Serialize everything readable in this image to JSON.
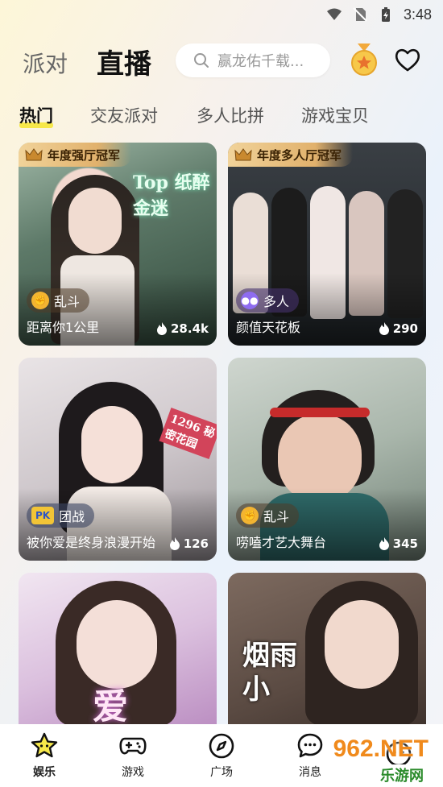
{
  "status": {
    "time": "3:48"
  },
  "header": {
    "tab_party": "派对",
    "tab_live": "直播",
    "search_placeholder": "赢龙佑千载..."
  },
  "subtabs": [
    "热门",
    "交友派对",
    "多人比拼",
    "游戏宝贝"
  ],
  "cards": [
    {
      "badge": "年度强厅冠军",
      "tag": "乱斗",
      "title": "距离你1公里",
      "heat": "28.4k",
      "overlay": "Top 纸醉金迷"
    },
    {
      "badge": "年度多人厅冠军",
      "tag": "多人",
      "title": "颜值天花板",
      "heat": "290"
    },
    {
      "tag": "团战",
      "tag_icon": "PK",
      "title": "被你爱是终身浪漫开始",
      "heat": "126",
      "overlay": "1296 秘密花园"
    },
    {
      "tag": "乱斗",
      "title": "唠嗑才艺大舞台",
      "heat": "345"
    },
    {
      "overlay": "爱"
    },
    {
      "overlay": "烟雨小"
    }
  ],
  "nav": [
    {
      "label": "娱乐",
      "icon": "star-icon"
    },
    {
      "label": "游戏",
      "icon": "gamepad-icon"
    },
    {
      "label": "广场",
      "icon": "compass-icon"
    },
    {
      "label": "消息",
      "icon": "chat-icon"
    },
    {
      "label": "",
      "icon": "profile-icon"
    }
  ],
  "watermark": {
    "main": "962.NET",
    "sub": "乐游网"
  },
  "colors": {
    "accent_yellow": "#f6e84a",
    "badge_gold": "#e1b16c"
  }
}
